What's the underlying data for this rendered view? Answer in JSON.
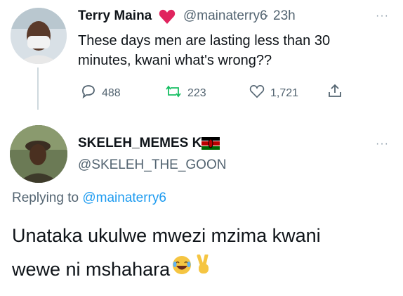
{
  "tweet1": {
    "name": "Terry Maina",
    "handle": "@mainaterry6",
    "separator": "·",
    "time": "23h",
    "text_line1": "These days men are lasting less than 30",
    "text_line2": "minutes, kwani what's wrong??",
    "more": "···",
    "actions": {
      "reply_count": "488",
      "retweet_count": "223",
      "like_count": "1,721"
    }
  },
  "tweet2": {
    "name": "SKELEH_MEMES KE",
    "handle": "@SKELEH_THE_GOON",
    "more": "···",
    "replying_label": "Replying to",
    "replying_handle": "@mainaterry6",
    "text_line1": "Unataka ukulwe mwezi mzima kwani",
    "text_line2": "wewe ni mshahara"
  },
  "colors": {
    "link": "#1d9bf0",
    "secondary_text": "#536471",
    "heart_emoji": "#e0245e",
    "retweet_icon": "#17bf63"
  },
  "icons": [
    "avatar-terry",
    "heart-emoji",
    "reply-icon",
    "retweet-icon",
    "like-icon",
    "share-icon",
    "avatar-skeleh",
    "kenya-flag-emoji",
    "laughing-emoji",
    "victory-hand-emoji"
  ]
}
